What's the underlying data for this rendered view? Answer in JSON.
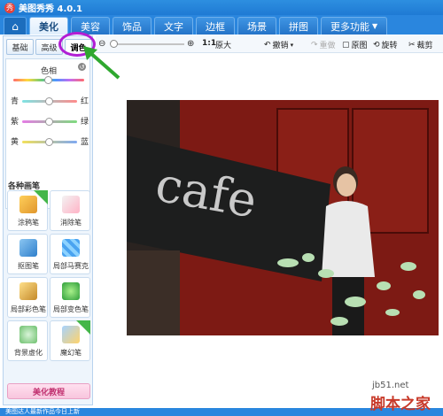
{
  "app": {
    "title": "美图秀秀 4.0.1",
    "logo": "秀"
  },
  "tabs": [
    {
      "label": "美化",
      "active": true
    },
    {
      "label": "美容"
    },
    {
      "label": "饰品"
    },
    {
      "label": "文字"
    },
    {
      "label": "边框"
    },
    {
      "label": "场景"
    },
    {
      "label": "拼图"
    },
    {
      "label": "更多功能"
    }
  ],
  "sidebar": {
    "subtabs": [
      "基础",
      "高级",
      "调色"
    ],
    "active_subtab": "调色",
    "hue_label": "色相",
    "sliders": [
      {
        "left": "青",
        "right": "红"
      },
      {
        "left": "紫",
        "right": "绿"
      },
      {
        "left": "黄",
        "right": "蓝"
      }
    ],
    "section_title": "各种画笔",
    "brushes": [
      {
        "label": "涂鸦笔",
        "icon": "pencil-icon",
        "badge": "新"
      },
      {
        "label": "消除笔",
        "icon": "eraser-icon"
      },
      {
        "label": "抠图笔",
        "icon": "cutout-pen-icon"
      },
      {
        "label": "局部马赛克",
        "icon": "mosaic-icon"
      },
      {
        "label": "局部彩色笔",
        "icon": "color-brush-icon"
      },
      {
        "label": "局部变色笔",
        "icon": "recolor-brush-icon"
      },
      {
        "label": "背景虚化",
        "icon": "blur-background-icon"
      },
      {
        "label": "魔幻笔",
        "icon": "magic-wand-icon",
        "badge": "新"
      }
    ],
    "tutorial_label": "美化教程"
  },
  "toolbar": {
    "ratio": "1:1",
    "original_size": "原大",
    "undo": "撤销",
    "redo": "重做",
    "original": "原图",
    "rotate": "旋转",
    "crop": "裁剪"
  },
  "photo": {
    "sign_text": "cafe"
  },
  "status": "美图达人最新作品今日上新",
  "watermark": {
    "url": "jb51.net",
    "name": "脚本之家"
  },
  "colors": {
    "accent": "#2a86de",
    "highlight": "#b21ed4",
    "arrow": "#2fa82f"
  }
}
